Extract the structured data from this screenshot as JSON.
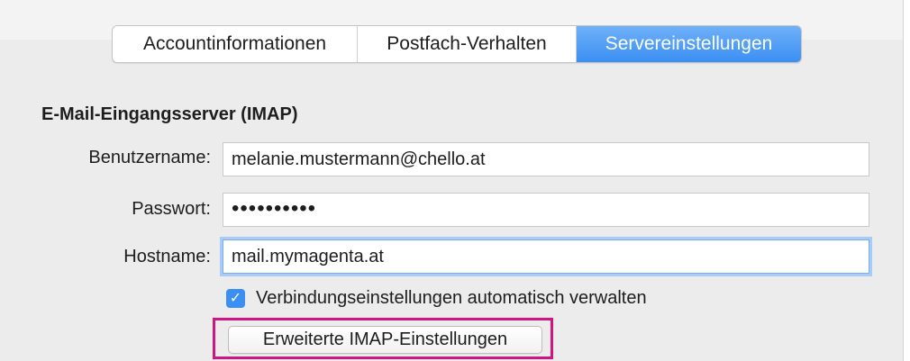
{
  "tabs": [
    {
      "label": "Accountinformationen",
      "active": false
    },
    {
      "label": "Postfach-Verhalten",
      "active": false
    },
    {
      "label": "Servereinstellungen",
      "active": true
    }
  ],
  "section": {
    "title": "E-Mail-Eingangsserver (IMAP)"
  },
  "fields": {
    "username": {
      "label": "Benutzername:",
      "value": "melanie.mustermann@chello.at"
    },
    "password": {
      "label": "Passwort:",
      "value": "••••••••••"
    },
    "hostname": {
      "label": "Hostname:",
      "value": "mail.mymagenta.at"
    }
  },
  "checkbox": {
    "label": "Verbindungseinstellungen automatisch verwalten",
    "checked": true
  },
  "advanced_button": {
    "label": "Erweiterte IMAP-Einstellungen"
  },
  "colors": {
    "accent": "#3b8ff3",
    "highlight_frame": "#d4147e",
    "panel_bg": "#ececec"
  }
}
